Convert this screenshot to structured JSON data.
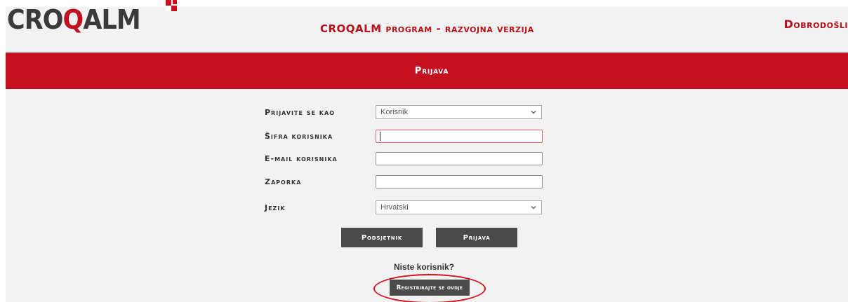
{
  "header": {
    "logo_text_prefix": "CRO",
    "logo_text_q": "Q",
    "logo_text_suffix": "ALM",
    "app_title": "CROQALM program - razvojna verzija",
    "welcome": "Dobrodošli"
  },
  "banner": {
    "title": "Prijava"
  },
  "form": {
    "login_as": {
      "label": "Prijavite se kao",
      "value": "Korisnik"
    },
    "user_code": {
      "label": "Šifra korisnika",
      "value": ""
    },
    "user_email": {
      "label": "E-mail korisnika",
      "value": ""
    },
    "password": {
      "label": "Zaporka",
      "value": ""
    },
    "language": {
      "label": "Jezik",
      "value": "Hrvatski"
    }
  },
  "buttons": {
    "reminder": "Podsjetnik",
    "login": "Prijava",
    "register": "Registrirajte se ovdje"
  },
  "not_user_text": "Niste korisnik?",
  "colors": {
    "brand_red": "#c4101f",
    "button_dark": "#4a4a4a",
    "panel_bg": "#f2f2f2"
  },
  "icons": {
    "select_arrow": "chevron-down-icon",
    "logo_mark": "checker-square-icon"
  }
}
